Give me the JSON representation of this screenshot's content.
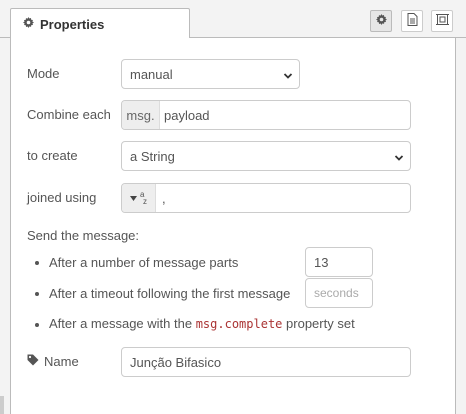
{
  "tabs": {
    "properties_label": "Properties"
  },
  "mode": {
    "label": "Mode",
    "value": "manual"
  },
  "combine": {
    "label": "Combine each",
    "prefix": "msg.",
    "value": "payload"
  },
  "create": {
    "label": "to create",
    "value": "a String"
  },
  "joiner": {
    "label": "joined using",
    "type_glyph": "a z",
    "value": ","
  },
  "send": {
    "heading": "Send the message:",
    "parts_label": "After a number of message parts",
    "parts_value": "13",
    "timeout_label": "After a timeout following the first message",
    "timeout_placeholder": "seconds",
    "complete_prefix": "After a message with the",
    "complete_code": "msg.complete",
    "complete_suffix": "property set"
  },
  "name": {
    "label": "Name",
    "value": "Junção Bifasico"
  },
  "icons": {
    "settings": "gear-icon",
    "description": "document-icon",
    "appearance": "frame-icon",
    "name": "tag-icon",
    "dropdown": "chevron-down-icon"
  }
}
